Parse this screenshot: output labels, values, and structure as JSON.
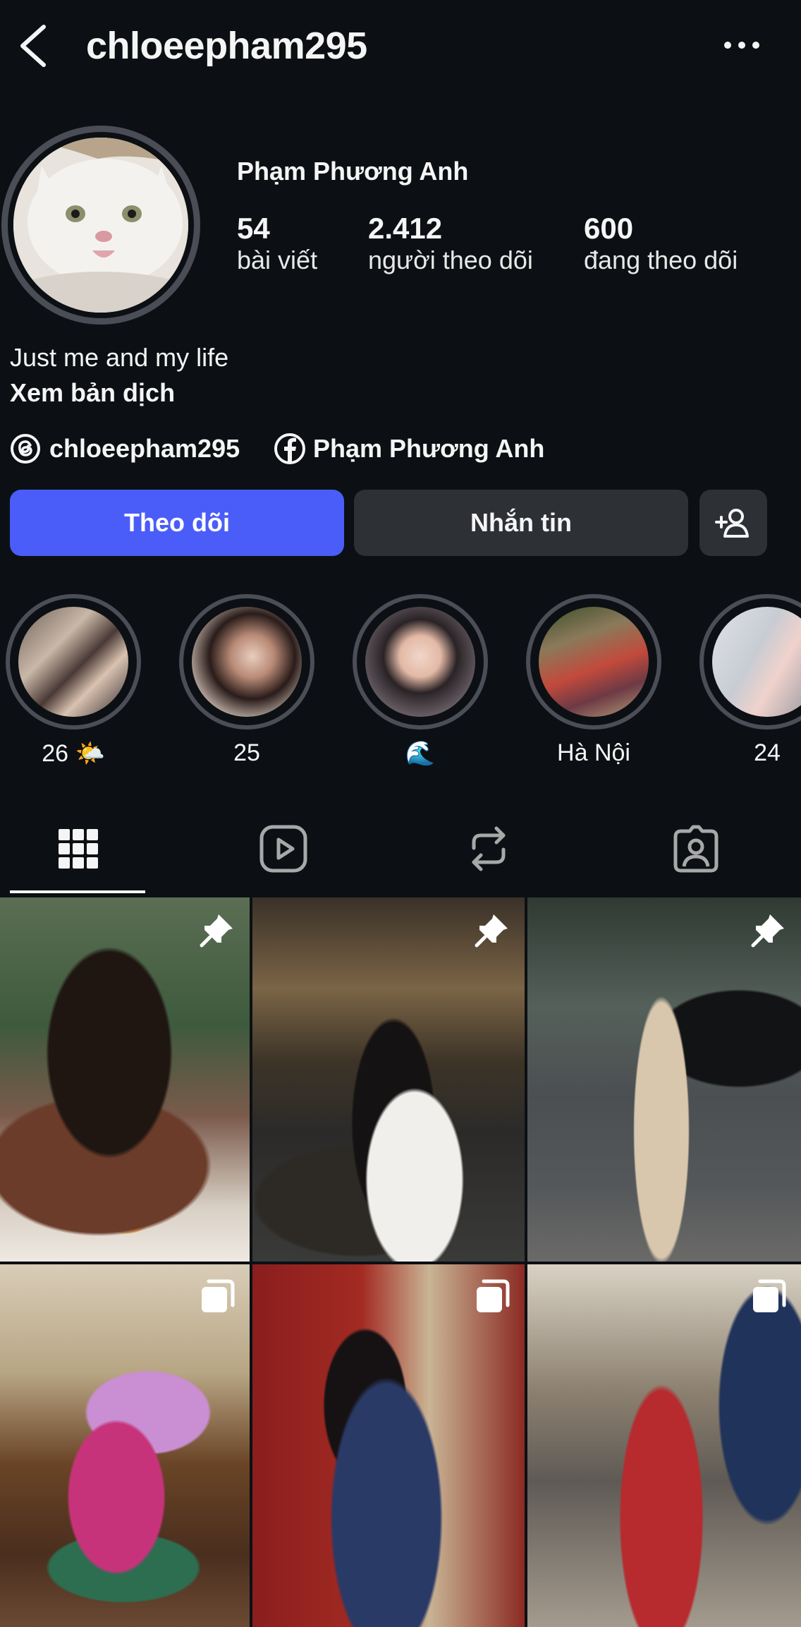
{
  "header": {
    "username": "chloeepham295"
  },
  "profile": {
    "full_name": "Phạm Phương Anh",
    "stats": [
      {
        "value": "54",
        "label": "bài viết"
      },
      {
        "value": "2.412",
        "label": "người theo dõi"
      },
      {
        "value": "600",
        "label": "đang theo dõi"
      }
    ],
    "bio": "Just me and my life",
    "translate_label": "Xem bản dịch",
    "threads_handle": "chloeepham295",
    "facebook_name": "Phạm Phương Anh"
  },
  "actions": {
    "follow_label": "Theo dõi",
    "message_label": "Nhắn tin"
  },
  "highlights": [
    {
      "label": "26 🌤️"
    },
    {
      "label": "25"
    },
    {
      "label": "🌊"
    },
    {
      "label": "Hà Nội"
    },
    {
      "label": "24"
    }
  ],
  "tabs": [
    {
      "icon": "grid-icon",
      "selected": true
    },
    {
      "icon": "reels-icon",
      "selected": false
    },
    {
      "icon": "reposts-icon",
      "selected": false
    },
    {
      "icon": "tagged-icon",
      "selected": false
    }
  ],
  "posts": [
    {
      "badge": "pin-icon"
    },
    {
      "badge": "pin-icon"
    },
    {
      "badge": "pin-icon"
    },
    {
      "badge": "carousel-icon"
    },
    {
      "badge": "carousel-icon"
    },
    {
      "badge": "carousel-icon"
    }
  ],
  "colors": {
    "background": "#0c1014",
    "accent": "#4a5df9",
    "button": "#2d3035"
  }
}
